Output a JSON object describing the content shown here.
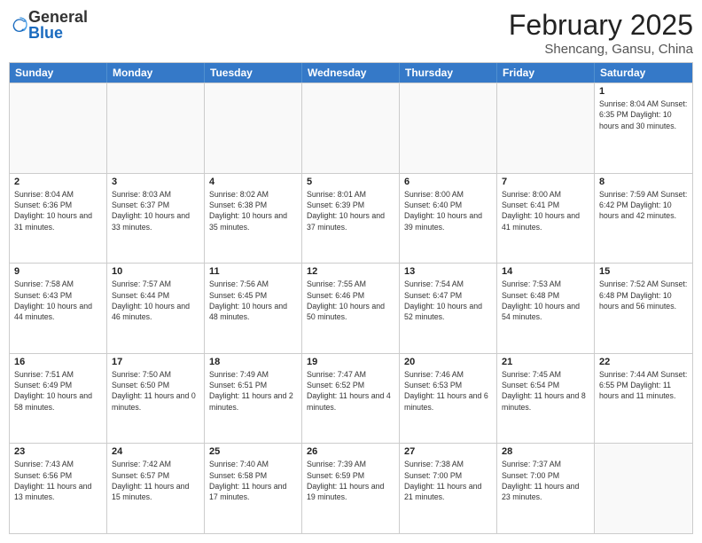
{
  "logo": {
    "general": "General",
    "blue": "Blue"
  },
  "title": "February 2025",
  "subtitle": "Shencang, Gansu, China",
  "header": {
    "days": [
      "Sunday",
      "Monday",
      "Tuesday",
      "Wednesday",
      "Thursday",
      "Friday",
      "Saturday"
    ]
  },
  "weeks": [
    [
      {
        "day": "",
        "info": ""
      },
      {
        "day": "",
        "info": ""
      },
      {
        "day": "",
        "info": ""
      },
      {
        "day": "",
        "info": ""
      },
      {
        "day": "",
        "info": ""
      },
      {
        "day": "",
        "info": ""
      },
      {
        "day": "1",
        "info": "Sunrise: 8:04 AM\nSunset: 6:35 PM\nDaylight: 10 hours and 30 minutes."
      }
    ],
    [
      {
        "day": "2",
        "info": "Sunrise: 8:04 AM\nSunset: 6:36 PM\nDaylight: 10 hours and 31 minutes."
      },
      {
        "day": "3",
        "info": "Sunrise: 8:03 AM\nSunset: 6:37 PM\nDaylight: 10 hours and 33 minutes."
      },
      {
        "day": "4",
        "info": "Sunrise: 8:02 AM\nSunset: 6:38 PM\nDaylight: 10 hours and 35 minutes."
      },
      {
        "day": "5",
        "info": "Sunrise: 8:01 AM\nSunset: 6:39 PM\nDaylight: 10 hours and 37 minutes."
      },
      {
        "day": "6",
        "info": "Sunrise: 8:00 AM\nSunset: 6:40 PM\nDaylight: 10 hours and 39 minutes."
      },
      {
        "day": "7",
        "info": "Sunrise: 8:00 AM\nSunset: 6:41 PM\nDaylight: 10 hours and 41 minutes."
      },
      {
        "day": "8",
        "info": "Sunrise: 7:59 AM\nSunset: 6:42 PM\nDaylight: 10 hours and 42 minutes."
      }
    ],
    [
      {
        "day": "9",
        "info": "Sunrise: 7:58 AM\nSunset: 6:43 PM\nDaylight: 10 hours and 44 minutes."
      },
      {
        "day": "10",
        "info": "Sunrise: 7:57 AM\nSunset: 6:44 PM\nDaylight: 10 hours and 46 minutes."
      },
      {
        "day": "11",
        "info": "Sunrise: 7:56 AM\nSunset: 6:45 PM\nDaylight: 10 hours and 48 minutes."
      },
      {
        "day": "12",
        "info": "Sunrise: 7:55 AM\nSunset: 6:46 PM\nDaylight: 10 hours and 50 minutes."
      },
      {
        "day": "13",
        "info": "Sunrise: 7:54 AM\nSunset: 6:47 PM\nDaylight: 10 hours and 52 minutes."
      },
      {
        "day": "14",
        "info": "Sunrise: 7:53 AM\nSunset: 6:48 PM\nDaylight: 10 hours and 54 minutes."
      },
      {
        "day": "15",
        "info": "Sunrise: 7:52 AM\nSunset: 6:48 PM\nDaylight: 10 hours and 56 minutes."
      }
    ],
    [
      {
        "day": "16",
        "info": "Sunrise: 7:51 AM\nSunset: 6:49 PM\nDaylight: 10 hours and 58 minutes."
      },
      {
        "day": "17",
        "info": "Sunrise: 7:50 AM\nSunset: 6:50 PM\nDaylight: 11 hours and 0 minutes."
      },
      {
        "day": "18",
        "info": "Sunrise: 7:49 AM\nSunset: 6:51 PM\nDaylight: 11 hours and 2 minutes."
      },
      {
        "day": "19",
        "info": "Sunrise: 7:47 AM\nSunset: 6:52 PM\nDaylight: 11 hours and 4 minutes."
      },
      {
        "day": "20",
        "info": "Sunrise: 7:46 AM\nSunset: 6:53 PM\nDaylight: 11 hours and 6 minutes."
      },
      {
        "day": "21",
        "info": "Sunrise: 7:45 AM\nSunset: 6:54 PM\nDaylight: 11 hours and 8 minutes."
      },
      {
        "day": "22",
        "info": "Sunrise: 7:44 AM\nSunset: 6:55 PM\nDaylight: 11 hours and 11 minutes."
      }
    ],
    [
      {
        "day": "23",
        "info": "Sunrise: 7:43 AM\nSunset: 6:56 PM\nDaylight: 11 hours and 13 minutes."
      },
      {
        "day": "24",
        "info": "Sunrise: 7:42 AM\nSunset: 6:57 PM\nDaylight: 11 hours and 15 minutes."
      },
      {
        "day": "25",
        "info": "Sunrise: 7:40 AM\nSunset: 6:58 PM\nDaylight: 11 hours and 17 minutes."
      },
      {
        "day": "26",
        "info": "Sunrise: 7:39 AM\nSunset: 6:59 PM\nDaylight: 11 hours and 19 minutes."
      },
      {
        "day": "27",
        "info": "Sunrise: 7:38 AM\nSunset: 7:00 PM\nDaylight: 11 hours and 21 minutes."
      },
      {
        "day": "28",
        "info": "Sunrise: 7:37 AM\nSunset: 7:00 PM\nDaylight: 11 hours and 23 minutes."
      },
      {
        "day": "",
        "info": ""
      }
    ]
  ]
}
